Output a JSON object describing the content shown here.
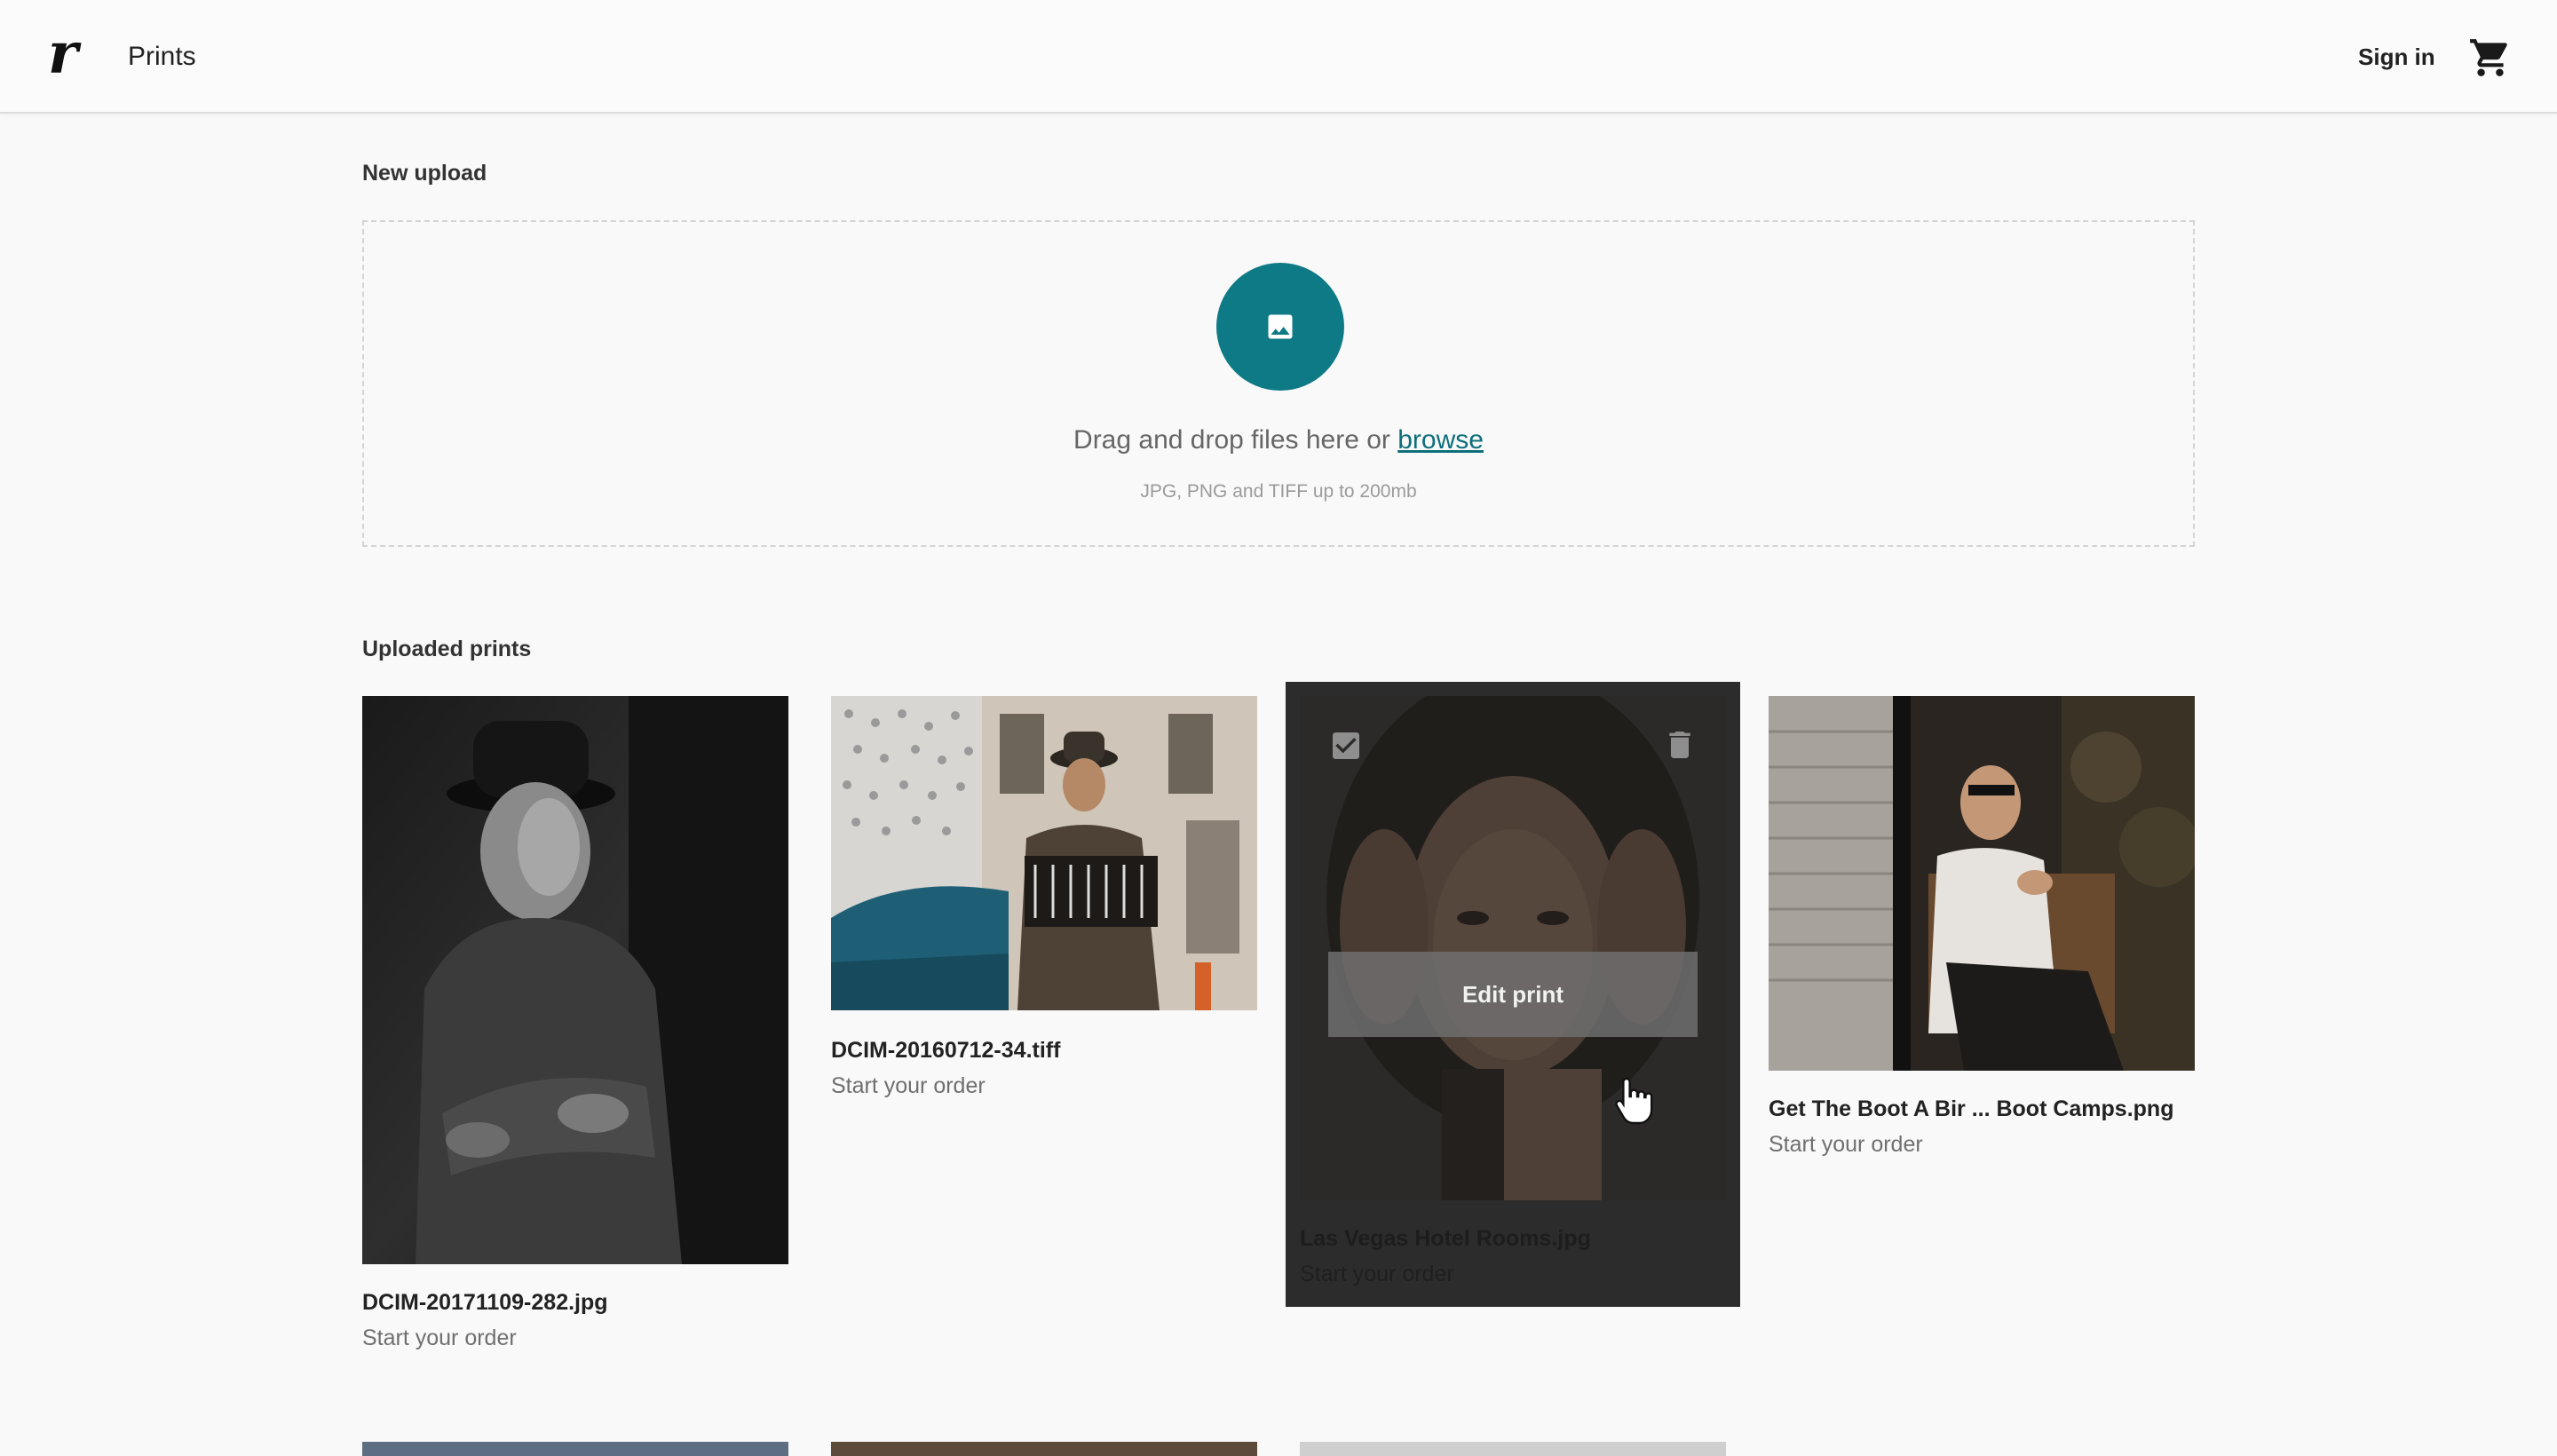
{
  "header": {
    "logo": "r",
    "title": "Prints",
    "signin_label": "Sign in",
    "cart_icon": "shopping-cart-icon"
  },
  "new_upload": {
    "label": "New upload",
    "drop_text": "Drag and drop files here or ",
    "browse_label": "browse",
    "hint": "JPG, PNG and TIFF up to 200mb",
    "icon": "image-icon",
    "accent_color": "#0e7a86"
  },
  "uploaded": {
    "label": "Uploaded prints",
    "items": [
      {
        "name": "DCIM-20171109-282.jpg",
        "status": "Start your order"
      },
      {
        "name": "DCIM-20160712-34.tiff",
        "status": "Start your order"
      },
      {
        "name": "Las Vegas Hotel Rooms.jpg",
        "status": "Start your order",
        "hover": true,
        "edit_label": "Edit print"
      },
      {
        "name": "Get The Boot A Bir ... Boot Camps.png",
        "status": "Start your order"
      }
    ]
  }
}
